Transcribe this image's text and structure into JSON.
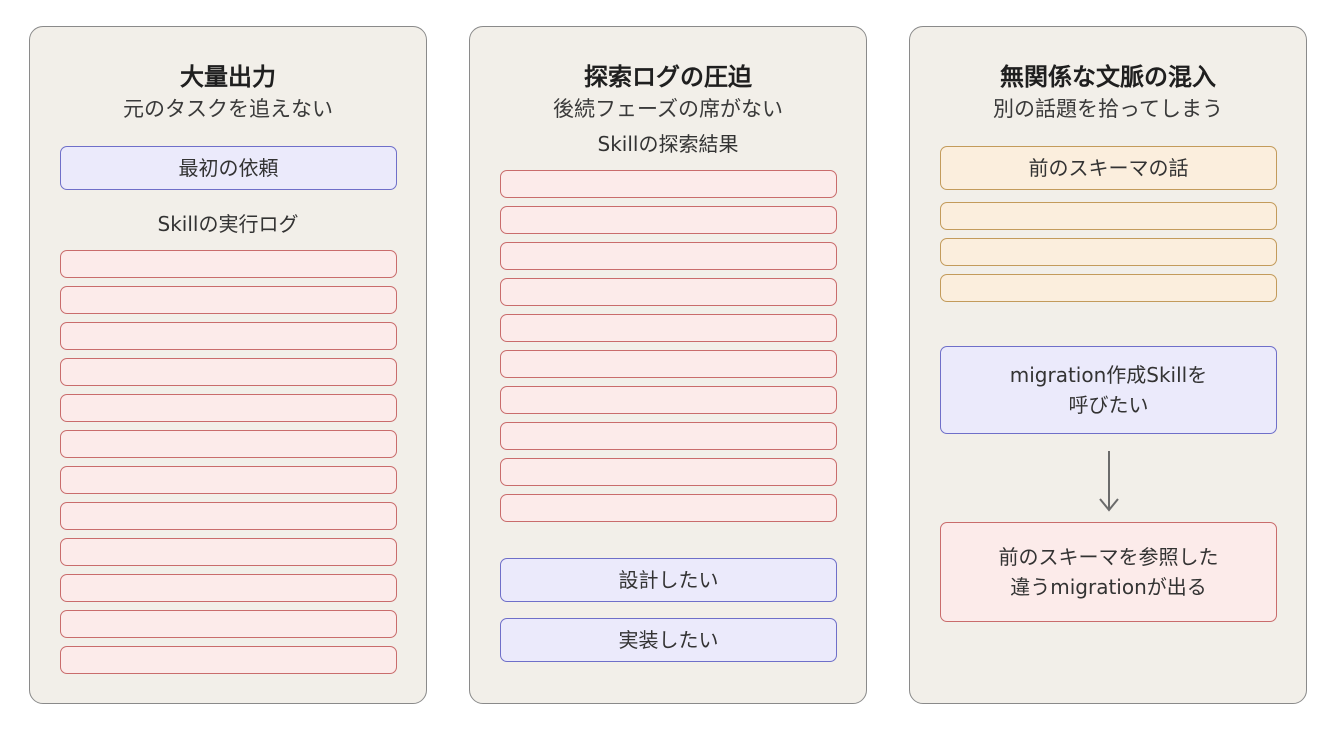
{
  "panels": [
    {
      "title": "大量出力",
      "subtitle": "元のタスクを追えない",
      "request_box": "最初の依頼",
      "log_label": "Skillの実行ログ",
      "log_bar_count": 12
    },
    {
      "title": "探索ログの圧迫",
      "subtitle": "後続フェーズの席がない",
      "log_label": "Skillの探索結果",
      "log_bar_count": 10,
      "phase_boxes": [
        "設計したい",
        "実装したい"
      ]
    },
    {
      "title": "無関係な文脈の混入",
      "subtitle": "別の話題を拾ってしまう",
      "context_box": "前のスキーマの話",
      "context_bar_count": 3,
      "request_box": [
        "migration作成Skillを",
        "呼びたい"
      ],
      "result_box": [
        "前のスキーマを参照した",
        "違うmigrationが出る"
      ]
    }
  ],
  "colors": {
    "panel_bg": "#f2efe9",
    "purple_fill": "#ebeafb",
    "purple_stroke": "#6f6fc9",
    "red_fill": "#fcebea",
    "red_stroke": "#c96c6c",
    "orange_fill": "#fbeedd",
    "orange_stroke": "#c39b5b",
    "arrow": "#6b6b6b"
  }
}
